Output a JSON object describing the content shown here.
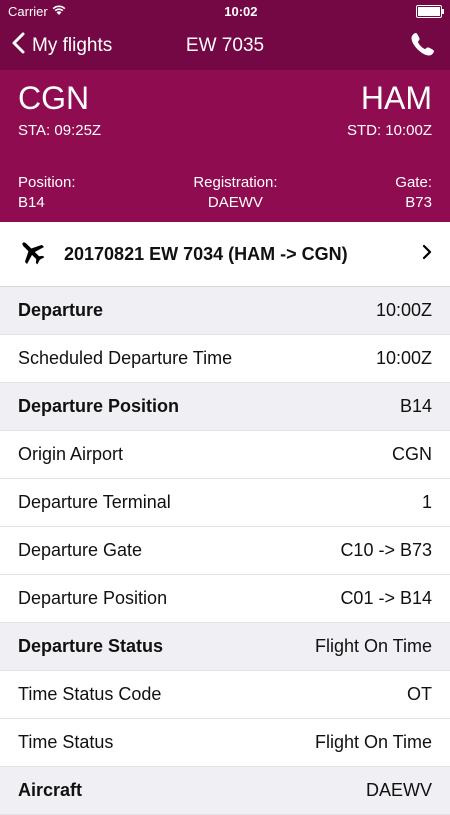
{
  "status_bar": {
    "carrier": "Carrier",
    "time": "10:02"
  },
  "nav": {
    "back_label": "My flights",
    "title": "EW 7035"
  },
  "route": {
    "origin": "CGN",
    "origin_time": "STA: 09:25Z",
    "destination": "HAM",
    "destination_time": "STD: 10:00Z"
  },
  "meta": {
    "position_label": "Position:",
    "position": "B14",
    "registration_label": "Registration:",
    "registration": "DAEWV",
    "gate_label": "Gate:",
    "gate": "B73"
  },
  "linked_flight": "20170821 EW 7034 (HAM -> CGN)",
  "rows": [
    {
      "label": "Departure",
      "value": "10:00Z",
      "section": true
    },
    {
      "label": "Scheduled Departure Time",
      "value": "10:00Z",
      "section": false
    },
    {
      "label": "Departure Position",
      "value": "B14",
      "section": true
    },
    {
      "label": "Origin Airport",
      "value": "CGN",
      "section": false
    },
    {
      "label": "Departure Terminal",
      "value": "1",
      "section": false
    },
    {
      "label": "Departure Gate",
      "value": "C10 -> B73",
      "section": false
    },
    {
      "label": "Departure Position",
      "value": "C01 -> B14",
      "section": false
    },
    {
      "label": "Departure Status",
      "value": "Flight On Time",
      "section": true
    },
    {
      "label": "Time Status Code",
      "value": "OT",
      "section": false
    },
    {
      "label": "Time Status",
      "value": "Flight On Time",
      "section": false
    },
    {
      "label": "Aircraft",
      "value": "DAEWV",
      "section": true
    }
  ]
}
